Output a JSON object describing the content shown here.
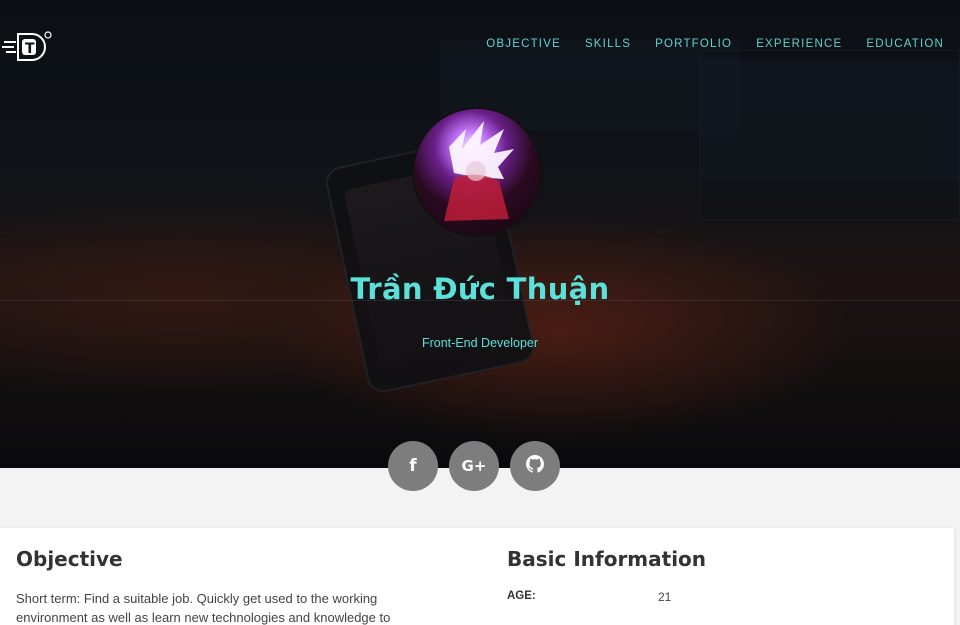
{
  "nav": {
    "items": [
      "OBJECTIVE",
      "SKILLS",
      "PORTFOLIO",
      "EXPERIENCE",
      "EDUCATION"
    ]
  },
  "hero": {
    "name": "Trần Đức Thuận",
    "role": "Front-End Developer"
  },
  "logo": {
    "letter": "T",
    "icon": "brand-logo-icon"
  },
  "socials": [
    {
      "icon": "facebook-icon",
      "glyph": "f"
    },
    {
      "icon": "google-plus-icon",
      "glyph": "G+"
    },
    {
      "icon": "github-icon",
      "glyph": "github"
    }
  ],
  "objective": {
    "title": "Objective",
    "text": "Short term: Find a suitable job. Quickly get used to the working environment as well as learn new technologies and knowledge to"
  },
  "basic_info": {
    "title": "Basic Information",
    "rows": [
      {
        "label": "AGE:",
        "value": "21"
      }
    ]
  },
  "colors": {
    "accent": "#59e1da",
    "social_bg": "#7d7d7d",
    "heading": "#333333"
  }
}
